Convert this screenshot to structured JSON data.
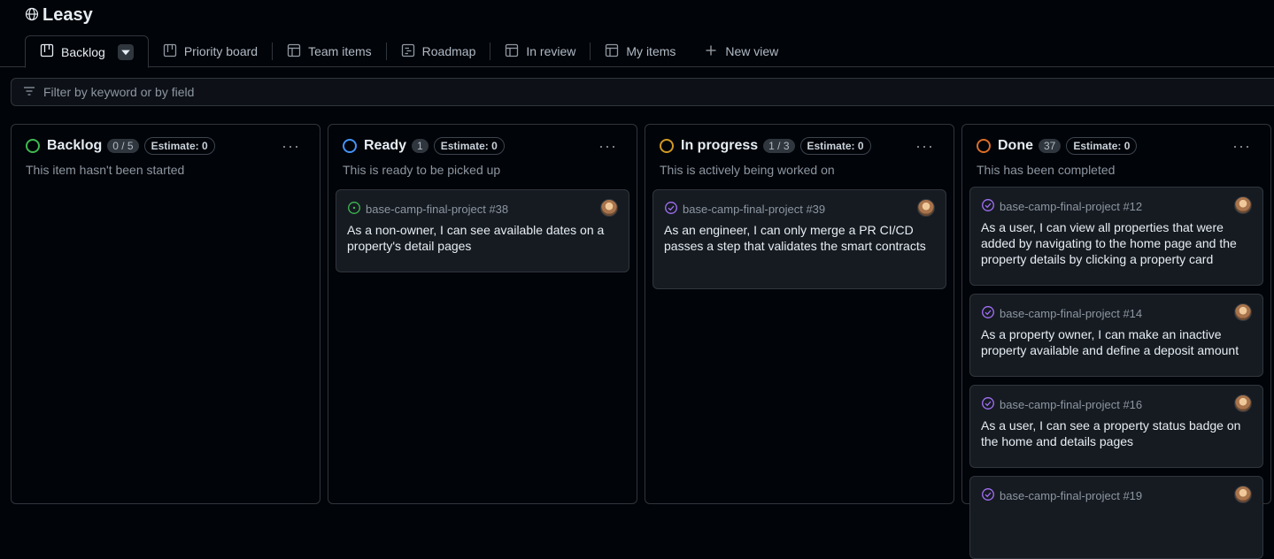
{
  "project": {
    "title": "Leasy"
  },
  "tabs": [
    {
      "label": "Backlog",
      "icon": "board-icon",
      "active": true
    },
    {
      "label": "Priority board",
      "icon": "board-icon"
    },
    {
      "label": "Team items",
      "icon": "table-icon"
    },
    {
      "label": "Roadmap",
      "icon": "roadmap-icon"
    },
    {
      "label": "In review",
      "icon": "table-icon"
    },
    {
      "label": "My items",
      "icon": "table-icon"
    },
    {
      "label": "New view",
      "icon": "plus-icon"
    }
  ],
  "filter": {
    "placeholder": "Filter by keyword or by field"
  },
  "colors": {
    "green": "#3fb950",
    "blue": "#4493f8",
    "yellow": "#d29922",
    "orange": "#db6d28",
    "purple": "#a371f7"
  },
  "columns": [
    {
      "name": "Backlog",
      "count": "0 / 5",
      "estimate": "Estimate: 0",
      "description": "This item hasn't been started",
      "status_color": "#3fb950",
      "cards": []
    },
    {
      "name": "Ready",
      "count": "1",
      "estimate": "Estimate: 0",
      "description": "This is ready to be picked up",
      "status_color": "#4493f8",
      "cards": [
        {
          "repo": "base-camp-final-project #38",
          "state": "open",
          "title": "As a non-owner, I can see available dates on a property's detail pages"
        }
      ]
    },
    {
      "name": "In progress",
      "count": "1 / 3",
      "estimate": "Estimate: 0",
      "description": "This is actively being worked on",
      "status_color": "#d29922",
      "cards": [
        {
          "repo": "base-camp-final-project #39",
          "state": "closed",
          "title": "As an engineer, I can only merge a PR CI/CD passes a step that validates the smart contracts"
        }
      ]
    },
    {
      "name": "Done",
      "count": "37",
      "estimate": "Estimate: 0",
      "description": "This has been completed",
      "status_color": "#db6d28",
      "cards": [
        {
          "repo": "base-camp-final-project #12",
          "state": "closed",
          "title": "As a user, I can view all properties that were added by navigating to the home page and the property details by clicking a property card"
        },
        {
          "repo": "base-camp-final-project #14",
          "state": "closed",
          "title": "As a property owner, I can make an inactive property available and define a deposit amount"
        },
        {
          "repo": "base-camp-final-project #16",
          "state": "closed",
          "title": "As a user, I can see a property status badge on the home and details pages"
        },
        {
          "repo": "base-camp-final-project #19",
          "state": "closed",
          "title": ""
        }
      ]
    }
  ]
}
